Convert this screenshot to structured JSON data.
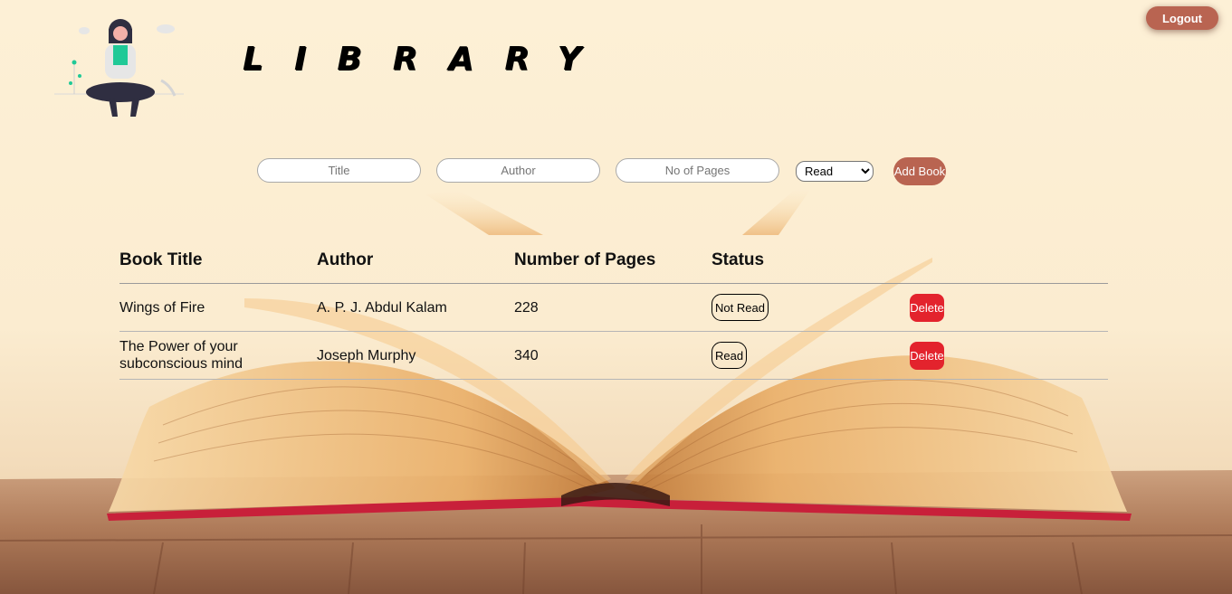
{
  "header": {
    "title": "LIBRARY",
    "logout_label": "Logout",
    "illustration_icon": "reading-person-illustration"
  },
  "form": {
    "title_placeholder": "Title",
    "author_placeholder": "Author",
    "pages_placeholder": "No of Pages",
    "status_selected": "Read",
    "add_button_label": "Add Book"
  },
  "table": {
    "headers": [
      "Book Title",
      "Author",
      "Number of Pages",
      "Status"
    ],
    "rows": [
      {
        "title": "Wings of Fire",
        "author": "A. P. J. Abdul Kalam",
        "pages": "228",
        "status": "Not Read",
        "delete_label": "Delete"
      },
      {
        "title": "The Power of your subconscious mind",
        "author": "Joseph Murphy",
        "pages": "340",
        "status": "Read",
        "delete_label": "Delete"
      }
    ]
  },
  "colors": {
    "accent": "#b96451",
    "delete": "#e3232d",
    "background": "#fdeed0"
  }
}
